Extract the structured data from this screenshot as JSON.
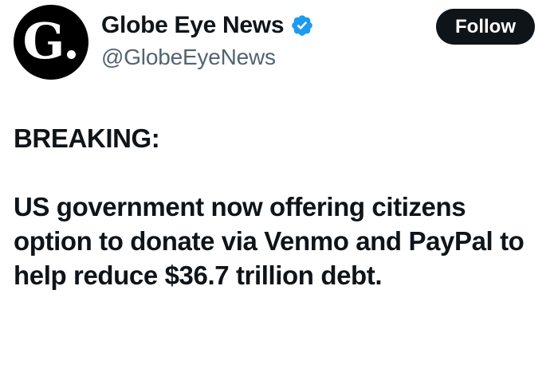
{
  "account": {
    "avatar_letter": "G",
    "display_name": "Globe Eye News",
    "handle": "@GlobeEyeNews",
    "verified_icon": "verified-badge-icon",
    "verified_color": "#1d9bf0"
  },
  "actions": {
    "follow_label": "Follow"
  },
  "tweet": {
    "label": "BREAKING:",
    "body": "US government now offering citizens option to donate via Venmo and PayPal to help reduce $36.7 trillion debt."
  }
}
